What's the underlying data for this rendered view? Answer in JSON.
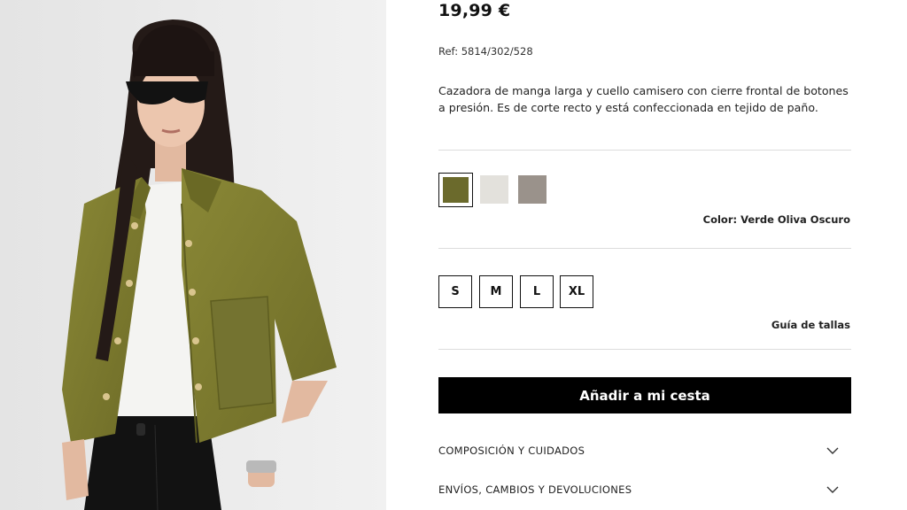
{
  "product": {
    "price": "19,99 €",
    "ref": "Ref: 5814/302/528",
    "description": "Cazadora de manga larga y cuello camisero con cierre frontal de botones a presión. Es de corte recto y está confeccionada en tejido de paño."
  },
  "colors": {
    "swatches": [
      {
        "hex": "#6b6a2c",
        "selected": true
      },
      {
        "hex": "#e3e1dc",
        "selected": false
      },
      {
        "hex": "#9a928b",
        "selected": false
      }
    ],
    "label": "Color: Verde Oliva Oscuro"
  },
  "sizes": {
    "options": [
      "S",
      "M",
      "L",
      "XL"
    ],
    "guide_label": "Guía de tallas"
  },
  "actions": {
    "add_to_cart": "Añadir a mi cesta"
  },
  "accordion": [
    {
      "label": "COMPOSICIÓN Y CUIDADOS",
      "icon": "chevron-down-icon"
    },
    {
      "label": "ENVÍOS, CAMBIOS Y DEVOLUCIONES",
      "icon": "chevron-down-icon"
    }
  ],
  "theme": {
    "jacket": "#7b7a30",
    "button_bg": "#000000"
  }
}
